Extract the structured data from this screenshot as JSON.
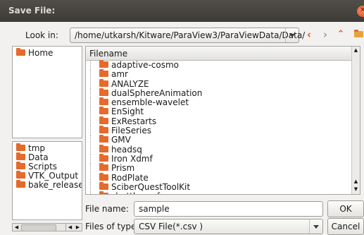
{
  "dialog": {
    "title": "Save File:"
  },
  "toolbar": {
    "look_in_label": "Look in:",
    "path": "/home/utkarsh/Kitware/ParaView3/ParaViewData/Data/",
    "back_icon": "chevron-left-icon",
    "forward_icon": "chevron-right-icon",
    "up_icon": "up-arrow-icon",
    "new_folder_icon": "new-folder-icon",
    "accent_color": "#e56a2c"
  },
  "favorites": {
    "items": [
      {
        "label": "Home"
      }
    ]
  },
  "recent": {
    "items": [
      {
        "label": "tmp"
      },
      {
        "label": "Data"
      },
      {
        "label": "Scripts"
      },
      {
        "label": "VTK_Output"
      },
      {
        "label": "bake_releaseab"
      }
    ]
  },
  "file_list": {
    "header": "Filename",
    "items": [
      "adaptive-cosmo",
      "amr",
      "ANALYZE",
      "dualSphereAnimation",
      "ensemble-wavelet",
      "EnSight",
      "ExRestarts",
      "FileSeries",
      "GMV",
      "headsq",
      "Iron Xdmf",
      "Prism",
      "RodPlate",
      "SciberQuestToolKit",
      "shuttle-surf"
    ]
  },
  "footer": {
    "file_name_label": "File name:",
    "file_name_value": "sample",
    "ok_label": "OK",
    "file_type_label": "Files of type:",
    "file_type_value": "CSV File(*.csv )",
    "cancel_label": "Cancel"
  }
}
